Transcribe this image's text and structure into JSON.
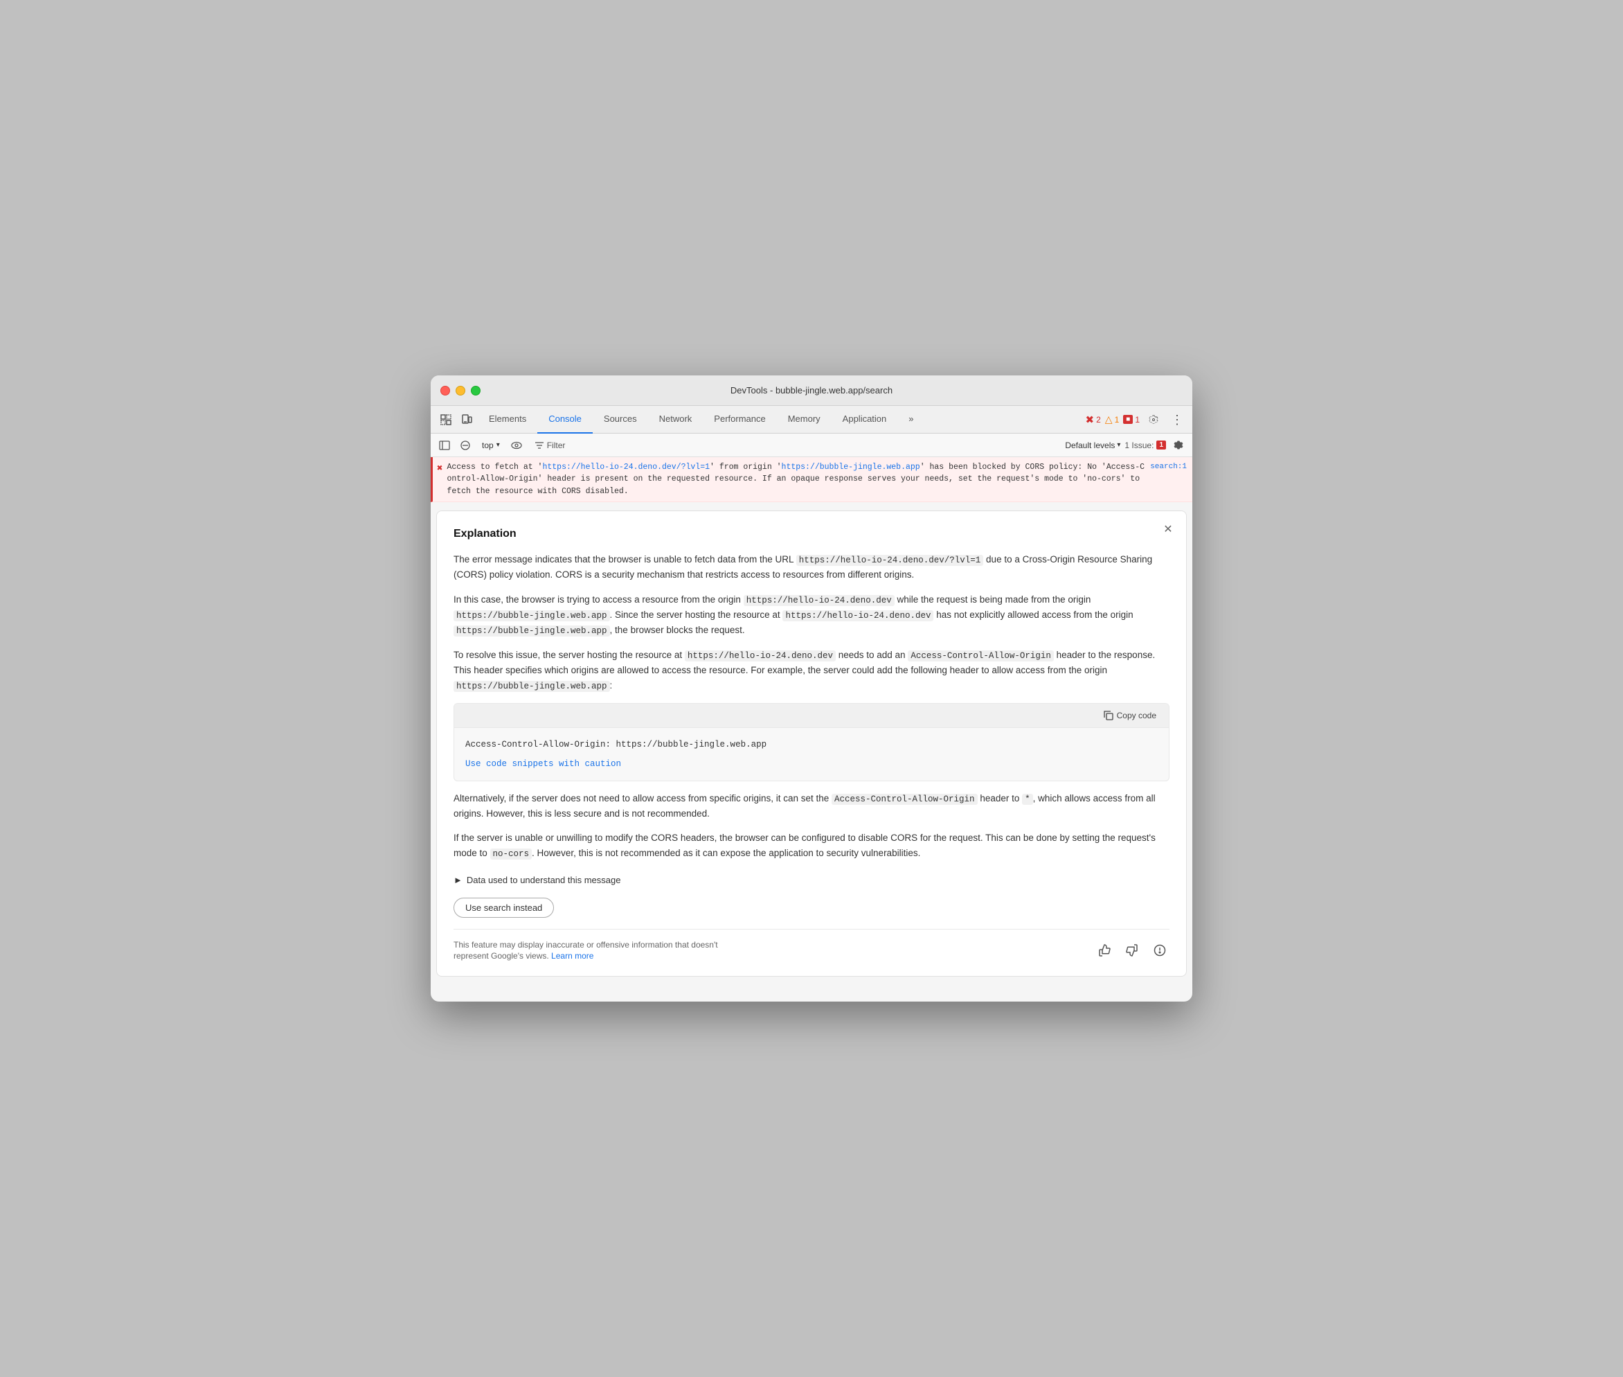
{
  "window": {
    "title": "DevTools - bubble-jingle.web.app/search"
  },
  "tabs": [
    {
      "id": "elements",
      "label": "Elements",
      "active": false
    },
    {
      "id": "console",
      "label": "Console",
      "active": true
    },
    {
      "id": "sources",
      "label": "Sources",
      "active": false
    },
    {
      "id": "network",
      "label": "Network",
      "active": false
    },
    {
      "id": "performance",
      "label": "Performance",
      "active": false
    },
    {
      "id": "memory",
      "label": "Memory",
      "active": false
    },
    {
      "id": "application",
      "label": "Application",
      "active": false
    }
  ],
  "toolbar_right": {
    "error_count": "2",
    "warn_count": "1",
    "info_count": "1"
  },
  "console_toolbar": {
    "context": "top",
    "filter_label": "Filter",
    "default_levels": "Default levels",
    "issues_label": "1 Issue:",
    "issues_count": "1"
  },
  "error_row": {
    "url1": "https://hello-io-24.deno.dev/?lvl=1",
    "url2": "https://bubble-jingle.web.app",
    "message_start": "Access to fetch at '",
    "message_mid": "' from origin '",
    "message_end": "' has been blocked by CORS policy: No 'Access-Control-Allow-Origin' header is present on the requested resource. If an opaque response serves your needs, set the request's mode to 'no-cors' to fetch the resource with CORS disabled.",
    "source": "search:1"
  },
  "explanation": {
    "title": "Explanation",
    "para1": "The error message indicates that the browser is unable to fetch data from the URL https://hello-io-24.deno.dev/?lvl=1 due to a Cross-Origin Resource Sharing (CORS) policy violation. CORS is a security mechanism that restricts access to resources from different origins.",
    "para2_pre": "In this case, the browser is trying to access a resource from the origin ",
    "para2_code1": "https://hello-io-24.deno.dev",
    "para2_mid": " while the request is being made from the origin ",
    "para2_code2": "https://bubble-jingle.web.app",
    "para2_post": ". Since the server hosting the resource at ",
    "para2_code3": "https://hello-io-24.deno.dev",
    "para2_end": " has not explicitly allowed access from the origin ",
    "para2_code4": "https://bubble-jingle.web.app",
    "para2_final": ", the browser blocks the request.",
    "para3_pre": "To resolve this issue, the server hosting the resource at ",
    "para3_code1": "https://hello-io-24.deno.dev",
    "para3_mid": " needs to add an ",
    "para3_code2": "Access-Control-Allow-Origin",
    "para3_post": " header to the response. This header specifies which origins are allowed to access the resource. For example, the server could add the following header to allow access from the origin ",
    "para3_code3": "https://bubble-jingle.web.app",
    "para3_final": ":",
    "code_snippet": "Access-Control-Allow-Origin: https://bubble-jingle.web.app",
    "copy_code_label": "Copy code",
    "caution_link": "Use code snippets with caution",
    "para4_pre": "Alternatively, if the server does not need to allow access from specific origins, it can set the ",
    "para4_code1": "Access-Control-Allow-Origin",
    "para4_mid": " header to ",
    "para4_code2": "*",
    "para4_end": ", which allows access from all origins. However, this is less secure and is not recommended.",
    "para5_pre": "If the server is unable or unwilling to modify the CORS headers, the browser can be configured to disable CORS for the request. This can be done by setting the request's mode to ",
    "para5_code1": "no-cors",
    "para5_end": ". However, this is not recommended as it can expose the application to security vulnerabilities.",
    "data_used_label": "Data used to understand this message",
    "use_search_label": "Use search instead",
    "footer_disclaimer": "This feature may display inaccurate or offensive information that doesn't represent Google's views.",
    "learn_more_label": "Learn more"
  }
}
